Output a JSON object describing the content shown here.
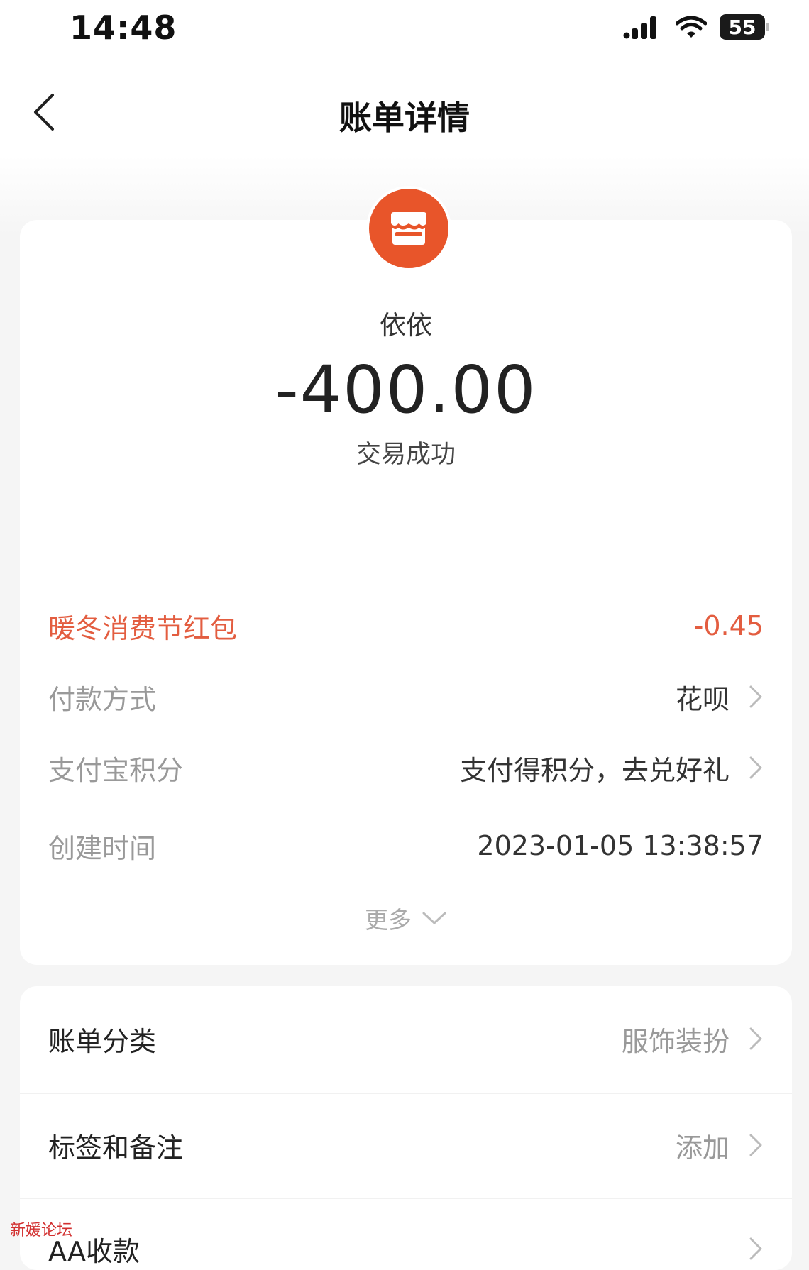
{
  "status_bar": {
    "time": "14:48",
    "battery": "55"
  },
  "nav": {
    "title": "账单详情"
  },
  "bill": {
    "merchant": "依依",
    "amount": "-400.00",
    "status": "交易成功",
    "details": [
      {
        "label": "暖冬消费节红包",
        "value": "-0.45"
      },
      {
        "label": "付款方式",
        "value": "花呗"
      },
      {
        "label": "支付宝积分",
        "value": "支付得积分，去兑好礼"
      },
      {
        "label": "创建时间",
        "value": "2023-01-05 13:38:57"
      }
    ],
    "more_label": "更多"
  },
  "extra": {
    "rows": [
      {
        "label": "账单分类",
        "value": "服饰装扮"
      },
      {
        "label": "标签和备注",
        "value": "添加"
      },
      {
        "label": "AA收款",
        "value": ""
      }
    ]
  },
  "watermark": "新媛论坛",
  "colors": {
    "accent_red": "#e35d40",
    "merchant_icon_bg": "#e8552a"
  }
}
